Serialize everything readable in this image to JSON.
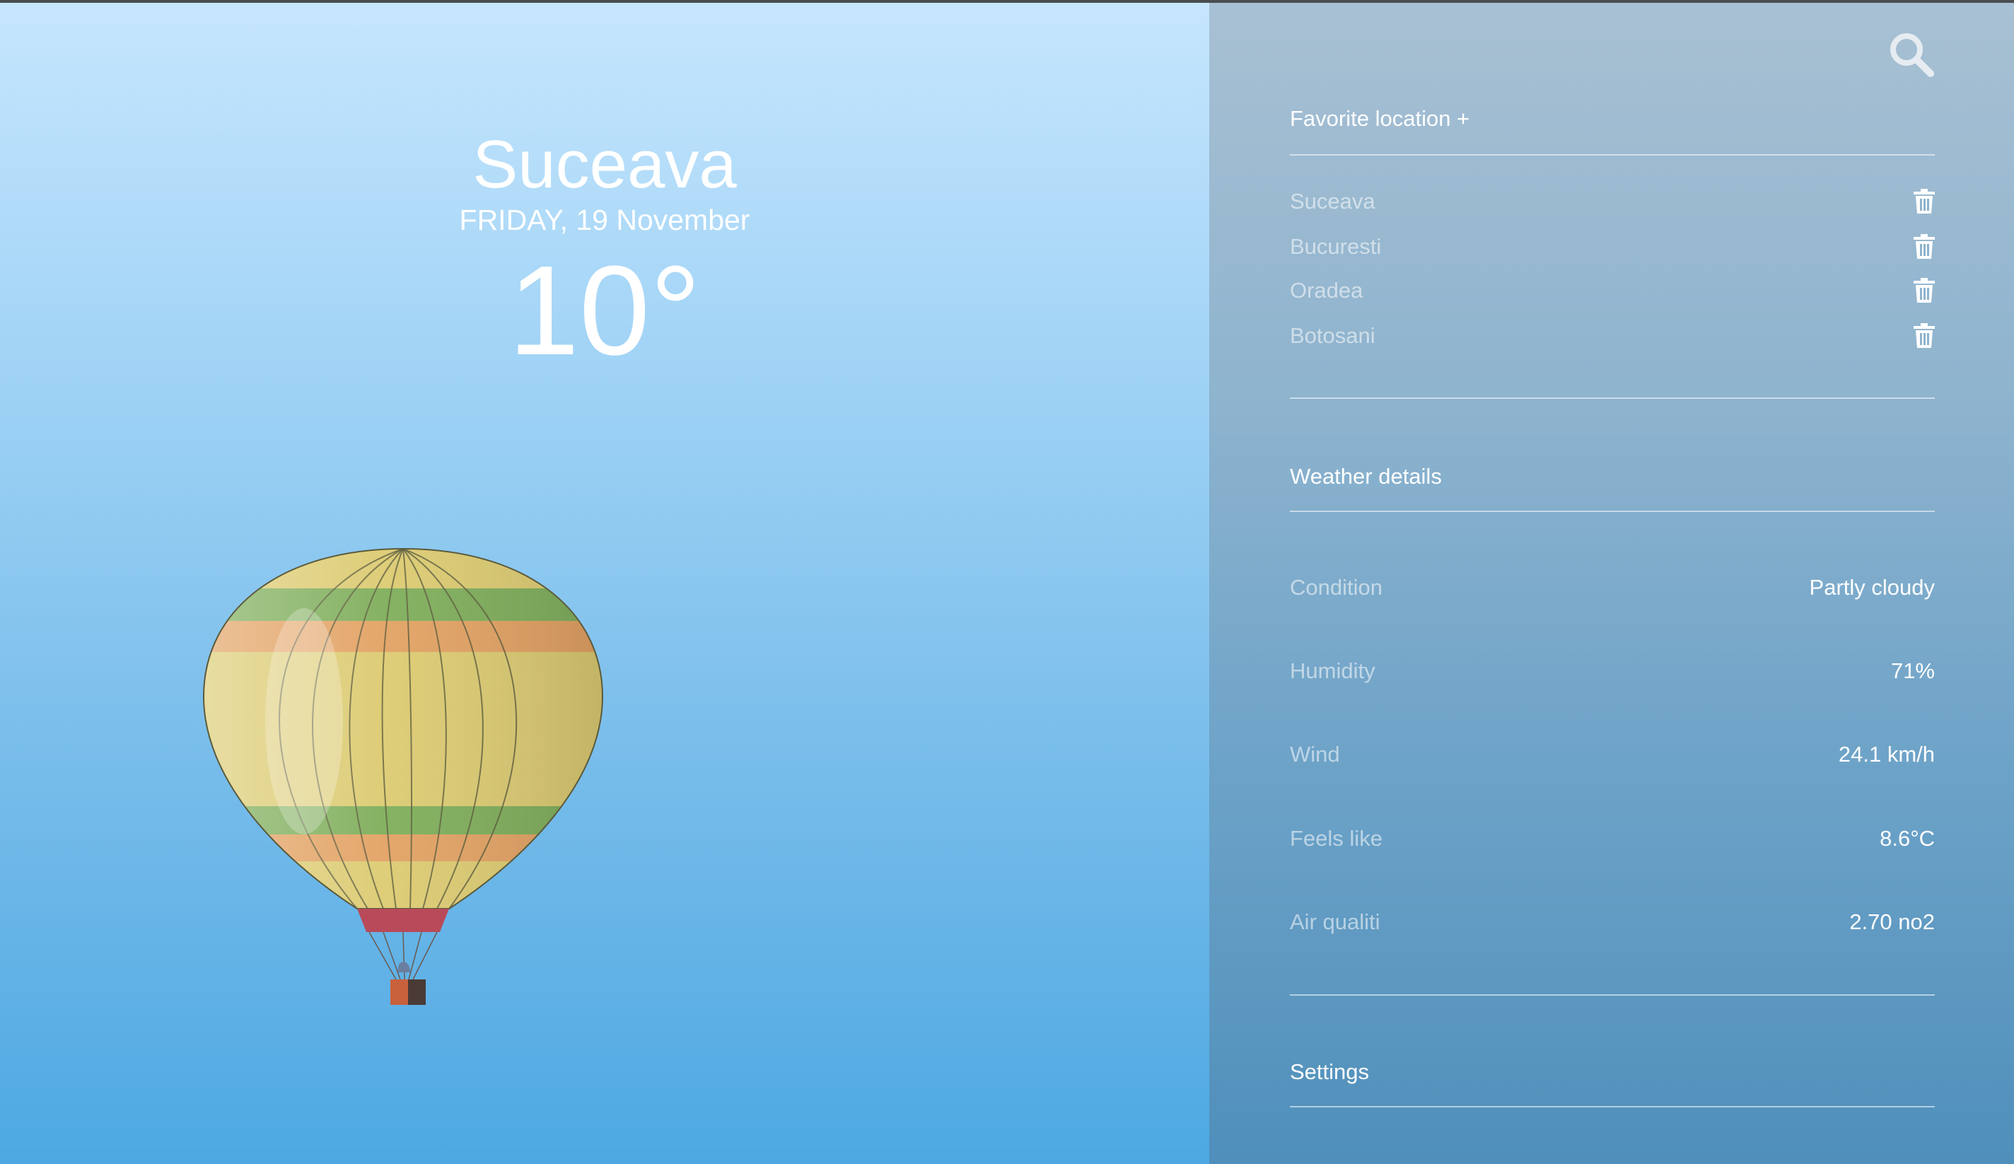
{
  "current": {
    "city": "Suceava",
    "date": "FRIDAY, 19 November",
    "temperature": "10°"
  },
  "sidebar": {
    "search_icon": "search-icon",
    "favorites_title": "Favorite location +",
    "favorites": [
      {
        "name": "Suceava"
      },
      {
        "name": "Bucuresti"
      },
      {
        "name": "Oradea"
      },
      {
        "name": "Botosani"
      }
    ],
    "details_title": "Weather details",
    "details": [
      {
        "label": "Condition",
        "value": "Partly cloudy"
      },
      {
        "label": "Humidity",
        "value": "71%"
      },
      {
        "label": "Wind",
        "value": "24.1 km/h"
      },
      {
        "label": "Feels like",
        "value": "8.6°C"
      },
      {
        "label": "Air qualiti",
        "value": "2.70 no2"
      }
    ],
    "settings_title": "Settings"
  },
  "colors": {
    "sky_top": "#c6e6fd",
    "sky_bottom": "#4da8e2",
    "panel_top": "#a8c0d3",
    "panel_bottom": "#4f8fbb"
  }
}
